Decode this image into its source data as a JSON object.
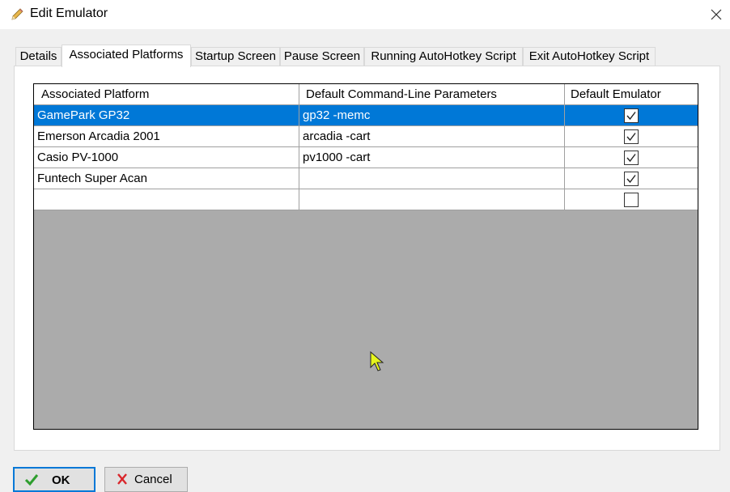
{
  "window": {
    "title": "Edit Emulator",
    "title_icon": "pencil-icon",
    "close_icon": "close-icon"
  },
  "tabs": [
    {
      "label": "Details",
      "active": false
    },
    {
      "label": "Associated Platforms",
      "active": true
    },
    {
      "label": "Startup Screen",
      "active": false
    },
    {
      "label": "Pause Screen",
      "active": false
    },
    {
      "label": "Running AutoHotkey Script",
      "active": false
    },
    {
      "label": "Exit AutoHotkey Script",
      "active": false
    }
  ],
  "grid": {
    "columns": [
      "Associated Platform",
      "Default Command-Line Parameters",
      "Default Emulator"
    ],
    "rows": [
      {
        "platform": "GamePark GP32",
        "params": "gp32 -memc",
        "default": true,
        "selected": true
      },
      {
        "platform": "Emerson Arcadia 2001",
        "params": "arcadia -cart",
        "default": true,
        "selected": false
      },
      {
        "platform": "Casio PV-1000",
        "params": "pv1000 -cart",
        "default": true,
        "selected": false
      },
      {
        "platform": "Funtech Super Acan",
        "params": "",
        "default": true,
        "selected": false
      },
      {
        "platform": "",
        "params": "",
        "default": false,
        "selected": false
      }
    ]
  },
  "buttons": {
    "ok_label": "OK",
    "ok_icon": "checkmark-icon",
    "cancel_label": "Cancel",
    "cancel_icon": "x-icon"
  },
  "colors": {
    "selection": "#0078d7",
    "grid_empty_area": "#ababab",
    "ok_check": "#2e9e2e",
    "cancel_x": "#d9262b"
  }
}
